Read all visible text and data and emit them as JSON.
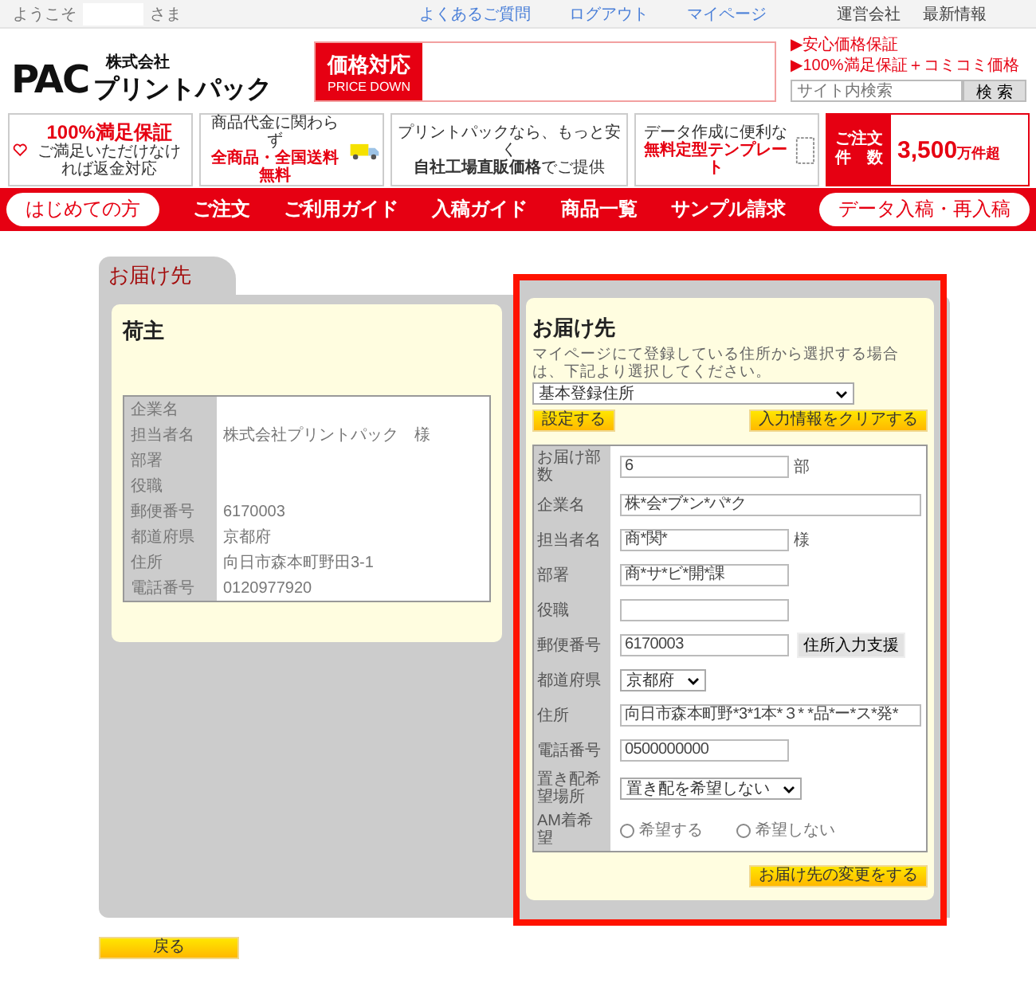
{
  "top_bar": {
    "welcome": "ようこそ",
    "honorific": "さま",
    "links": [
      {
        "label": "よくあるご質問",
        "kind": "link"
      },
      {
        "label": "ログアウト",
        "kind": "link"
      },
      {
        "label": "マイページ",
        "kind": "link"
      },
      {
        "label": "運営会社",
        "kind": "info"
      },
      {
        "label": "最新情報",
        "kind": "info"
      }
    ]
  },
  "header": {
    "logo": {
      "mark": "PAC",
      "company_type": "株式会社",
      "name": "プリントパック"
    },
    "price_banner": {
      "title": "価格対応",
      "subtitle": "PRICE DOWN"
    },
    "guarantees": [
      "▶安心価格保証",
      "▶100%満足保証＋コミコミ価格"
    ],
    "search": {
      "placeholder": "サイト内検索",
      "button": "検 索"
    }
  },
  "promos": [
    {
      "kind": "heart",
      "headline": "100%満足保証",
      "caption": "ご満足いただけなければ返金対応"
    },
    {
      "kind": "truck",
      "headline": "商品代金に関わらず",
      "caption": "全商品・全国送料無料"
    },
    {
      "kind": "plain",
      "headline": "プリントパックなら、もっと安く",
      "caption": "**自社工場直販価格**でご提供"
    },
    {
      "kind": "template",
      "headline": "データ作成に便利な",
      "caption": "無料定型テンプレート"
    },
    {
      "kind": "count",
      "headline": "ご注文",
      "caption": "件　数",
      "number": "3,500",
      "unit": "万件超"
    }
  ],
  "nav": [
    {
      "label": "はじめての方",
      "kind": "pill"
    },
    {
      "label": "ご注文",
      "kind": "plain"
    },
    {
      "label": "ご利用ガイド",
      "kind": "plain"
    },
    {
      "label": "入稿ガイド",
      "kind": "plain"
    },
    {
      "label": "商品一覧",
      "kind": "plain"
    },
    {
      "label": "サンプル請求",
      "kind": "plain"
    },
    {
      "label": "データ入稿・再入稿",
      "kind": "pill"
    }
  ],
  "section_tab": "お届け先",
  "shipper": {
    "title": "荷主",
    "rows": [
      {
        "label": "企業名",
        "value": ""
      },
      {
        "label": "担当者名",
        "value": "株式会社プリントパック　様"
      },
      {
        "label": "部署",
        "value": ""
      },
      {
        "label": "役職",
        "value": ""
      },
      {
        "label": "郵便番号",
        "value": "6170003"
      },
      {
        "label": "都道府県",
        "value": "京都府"
      },
      {
        "label": "住所",
        "value": "向日市森本町野田3-1"
      },
      {
        "label": "電話番号",
        "value": "0120977920"
      }
    ]
  },
  "delivery": {
    "title": "お届け先",
    "note": "マイページにて登録している住所から選択する場合は、下記より選択してください。",
    "address_select": "基本登録住所",
    "set_button": "設定する",
    "clear_button": "入力情報をクリアする",
    "rows": [
      {
        "label": "お届け部数",
        "kind": "text",
        "value": "6",
        "suffix": "部"
      },
      {
        "label": "企業名",
        "kind": "wide-text",
        "value": "株*会*ブ*ン*パ*ク"
      },
      {
        "label": "担当者名",
        "kind": "text",
        "value": "商*関*",
        "suffix": "様"
      },
      {
        "label": "部署",
        "kind": "text",
        "value": "商*サ*ビ*開*課"
      },
      {
        "label": "役職",
        "kind": "text",
        "value": ""
      },
      {
        "label": "郵便番号",
        "kind": "text",
        "value": "6170003",
        "action": "住所入力支援"
      },
      {
        "label": "都道府県",
        "kind": "select",
        "value": "京都府"
      },
      {
        "label": "住所",
        "kind": "wide-text",
        "value": "向日市森本町野*3*1本*３*  *品*ー*ス*発*"
      },
      {
        "label": "電話番号",
        "kind": "text",
        "value": "0500000000"
      },
      {
        "label": "置き配希望場所",
        "kind": "select",
        "value": "置き配を希望しない"
      },
      {
        "label": "AM着希望",
        "kind": "radio",
        "options": [
          {
            "label": "希望する",
            "selected": false
          },
          {
            "label": "希望しない",
            "selected": false
          }
        ]
      }
    ],
    "submit_button": "お届け先の変更をする"
  },
  "back_button": "戻る"
}
